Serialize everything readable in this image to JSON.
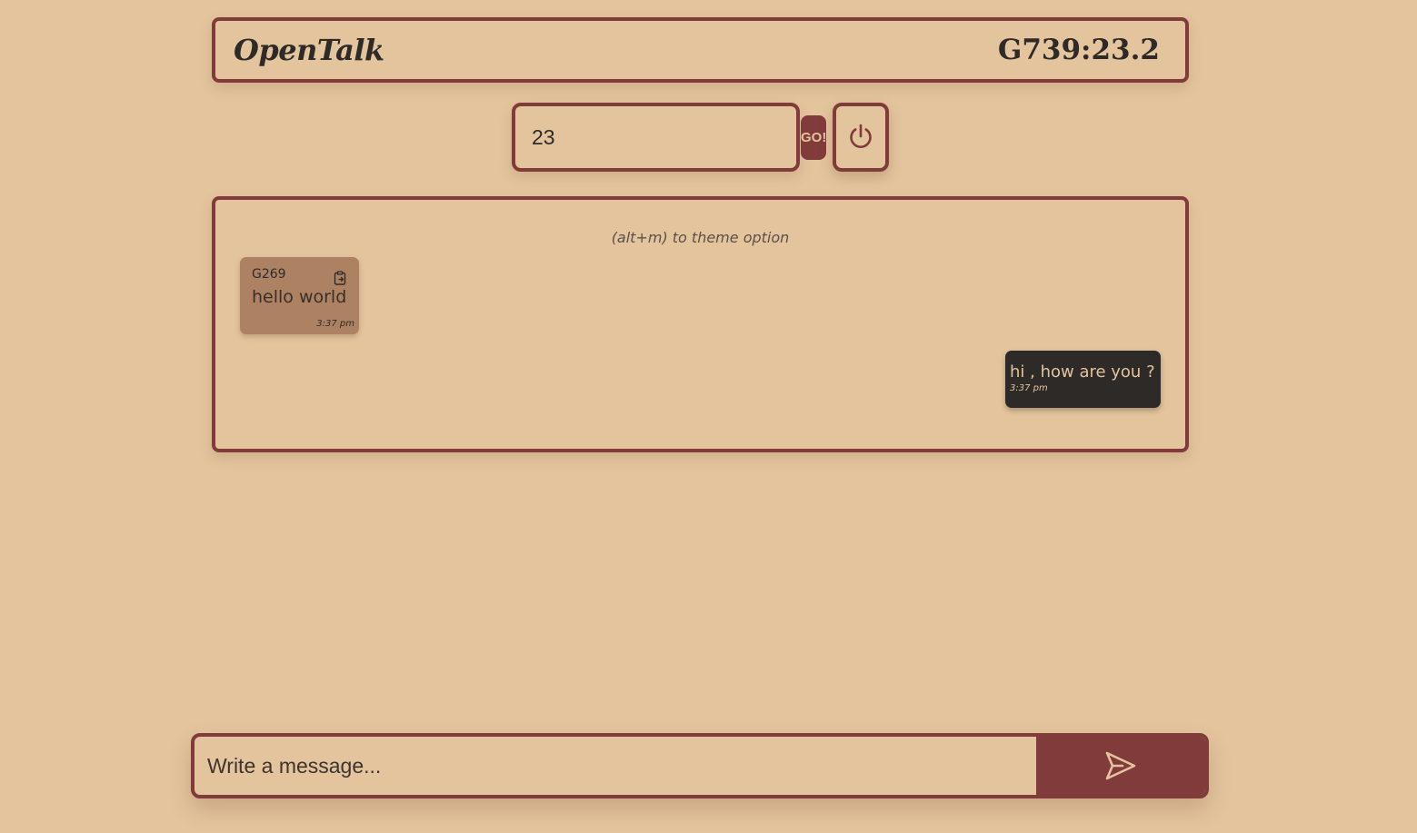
{
  "header": {
    "brand": "OpenTalk",
    "room_id": "G739:23.2"
  },
  "join": {
    "room_value": "23",
    "go_label": "GO!",
    "power_icon": "power-icon"
  },
  "chat": {
    "hint": "(alt+m)  to theme option",
    "messages": [
      {
        "sender": "G269",
        "text": "hello world",
        "time": "3:37 pm",
        "incoming": true,
        "icon": "clipboard-copy-icon"
      },
      {
        "text": "hi , how are you ?",
        "time": "3:37 pm",
        "incoming": false
      }
    ]
  },
  "composer": {
    "placeholder": "Write a message...",
    "send_icon": "send-icon"
  },
  "colors": {
    "background": "#e3c49d",
    "accent": "#823b3b",
    "dark": "#2e2a28",
    "incoming_bubble": "#ad8262"
  }
}
